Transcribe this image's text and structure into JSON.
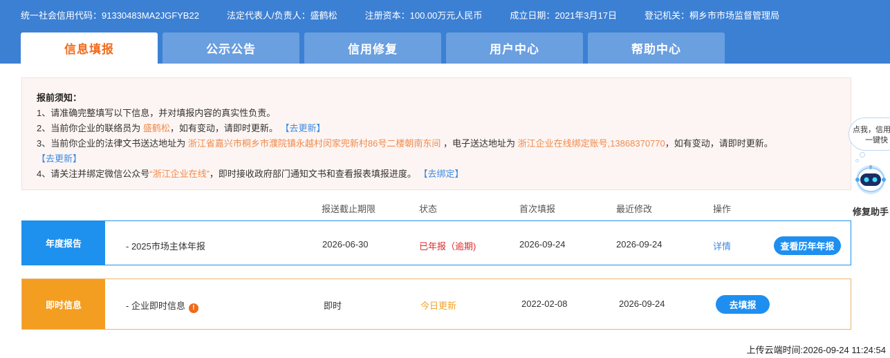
{
  "header": {
    "info": [
      {
        "label": "统一社会信用代码：",
        "value": "91330483MA2JGFYB22"
      },
      {
        "label": "法定代表人/负责人：",
        "value": "盛鹤松"
      },
      {
        "label": "注册资本：",
        "value": "100.00万元人民币"
      },
      {
        "label": "成立日期：",
        "value": "2021年3月17日"
      },
      {
        "label": "登记机关：",
        "value": "桐乡市市场监督管理局"
      }
    ]
  },
  "tabs": [
    {
      "label": "信息填报",
      "active": true
    },
    {
      "label": "公示公告"
    },
    {
      "label": "信用修复"
    },
    {
      "label": "用户中心"
    },
    {
      "label": "帮助中心"
    }
  ],
  "notice": {
    "title": "报前须知：",
    "line1": "1、请准确完整填写以下信息，并对填报内容的真实性负责。",
    "line2_pre": "2、当前你企业的联络员为",
    "line2_name": "盛鹤松",
    "line2_post": "，如有变动，请即时更新。",
    "line2_link": "【去更新】",
    "line3_pre": "3、当前你企业的法律文书送达地址为",
    "line3_addr": "浙江省嘉兴市桐乡市濮院镇永越村闵家兜新村86号二楼朝南东间",
    "line3_mid": "，电子送达地址为",
    "line3_email": "浙江企业在线绑定账号,13868370770",
    "line3_post": "，如有变动，请即时更新。",
    "line3_link": "【去更新】",
    "line4_pre": "4、请关注并绑定微信公众号",
    "line4_account": "“浙江企业在线”",
    "line4_post": "，即时接收政府部门通知文书和查看报表填报进度。",
    "line4_link": "【去绑定】"
  },
  "table": {
    "headers": {
      "deadline": "报送截止期限",
      "status": "状态",
      "first": "首次填报",
      "modified": "最近修改",
      "action": "操作"
    },
    "annual": {
      "badge": "年度报告",
      "name": "- 2025市场主体年报",
      "deadline": "2026-06-30",
      "status": "已年报（逾期)",
      "first": "2026-09-24",
      "modified": "2026-09-24",
      "detail": "详情",
      "history_btn": "查看历年年报"
    },
    "instant": {
      "badge": "即时信息",
      "name": "- 企业即时信息",
      "warn": "!",
      "deadline": "即时",
      "status": "今日更新",
      "first": "2022-02-08",
      "modified": "2026-09-24",
      "fill_btn": "去填报"
    }
  },
  "upload": "上传云端时间:2026-09-24 11:24:54",
  "assistant": {
    "bubble_line1": "点我，信用",
    "bubble_line2": "一键快",
    "label": "修复助手"
  },
  "colors": {
    "header": "#3c80d4",
    "tab": "#6a9fe0",
    "active_tab_text": "#f26b1c",
    "annual": "#1e90ee",
    "instant": "#f39d21"
  }
}
